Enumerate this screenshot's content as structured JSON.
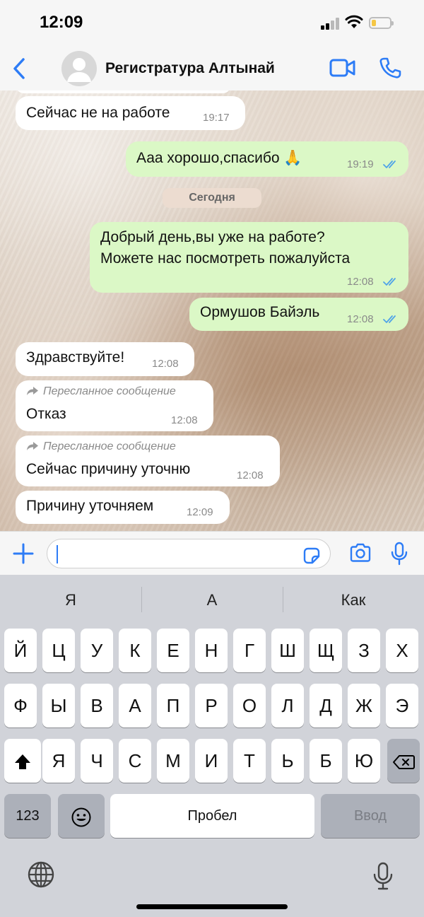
{
  "status_bar": {
    "time": "12:09"
  },
  "header": {
    "contact_name": "Регистратура Алтынай"
  },
  "messages": [
    {
      "dir": "in",
      "text": "Сейчас не на работе",
      "time": "19:17"
    },
    {
      "dir": "out",
      "text": "Ааа хорошо,спасибо 🙏",
      "time": "19:19",
      "read": true
    },
    {
      "dir": "out",
      "lines": [
        "Добрый день,вы уже на работе?",
        "Можете нас посмотреть пожалуйста"
      ],
      "time": "12:08",
      "read": true
    },
    {
      "dir": "out",
      "text": "Ормушов Байэль",
      "time": "12:08",
      "read": true
    },
    {
      "dir": "in",
      "text": "Здравствуйте!",
      "time": "12:08"
    },
    {
      "dir": "in",
      "forwarded_label": "Пересланное сообщение",
      "text": "Отказ",
      "time": "12:08"
    },
    {
      "dir": "in",
      "forwarded_label": "Пересланное сообщение",
      "text": "Сейчас причину уточню",
      "time": "12:08"
    },
    {
      "dir": "in",
      "text": "Причину уточняем",
      "time": "12:09"
    }
  ],
  "date_separator": "Сегодня",
  "input": {
    "value": ""
  },
  "keyboard": {
    "suggestions": [
      "Я",
      "А",
      "Как"
    ],
    "row1": [
      "Й",
      "Ц",
      "У",
      "К",
      "Е",
      "Н",
      "Г",
      "Ш",
      "Щ",
      "З",
      "Х"
    ],
    "row2": [
      "Ф",
      "Ы",
      "В",
      "А",
      "П",
      "Р",
      "О",
      "Л",
      "Д",
      "Ж",
      "Э"
    ],
    "row3": [
      "Я",
      "Ч",
      "С",
      "М",
      "И",
      "Т",
      "Ь",
      "Б",
      "Ю"
    ],
    "numbers_key": "123",
    "space_key": "Пробел",
    "return_key": "Ввод"
  },
  "colors": {
    "accent": "#2d7cf6",
    "outgoing_bubble": "#dbf8c6",
    "incoming_bubble": "#ffffff",
    "read_ticks": "#4fa3e8"
  },
  "icons": [
    "back-chevron-icon",
    "avatar-icon",
    "video-call-icon",
    "phone-icon",
    "plus-icon",
    "sticker-icon",
    "camera-icon",
    "microphone-icon",
    "globe-icon",
    "shift-icon",
    "backspace-icon",
    "emoji-icon",
    "forwarded-arrow-icon",
    "double-check-icon"
  ]
}
